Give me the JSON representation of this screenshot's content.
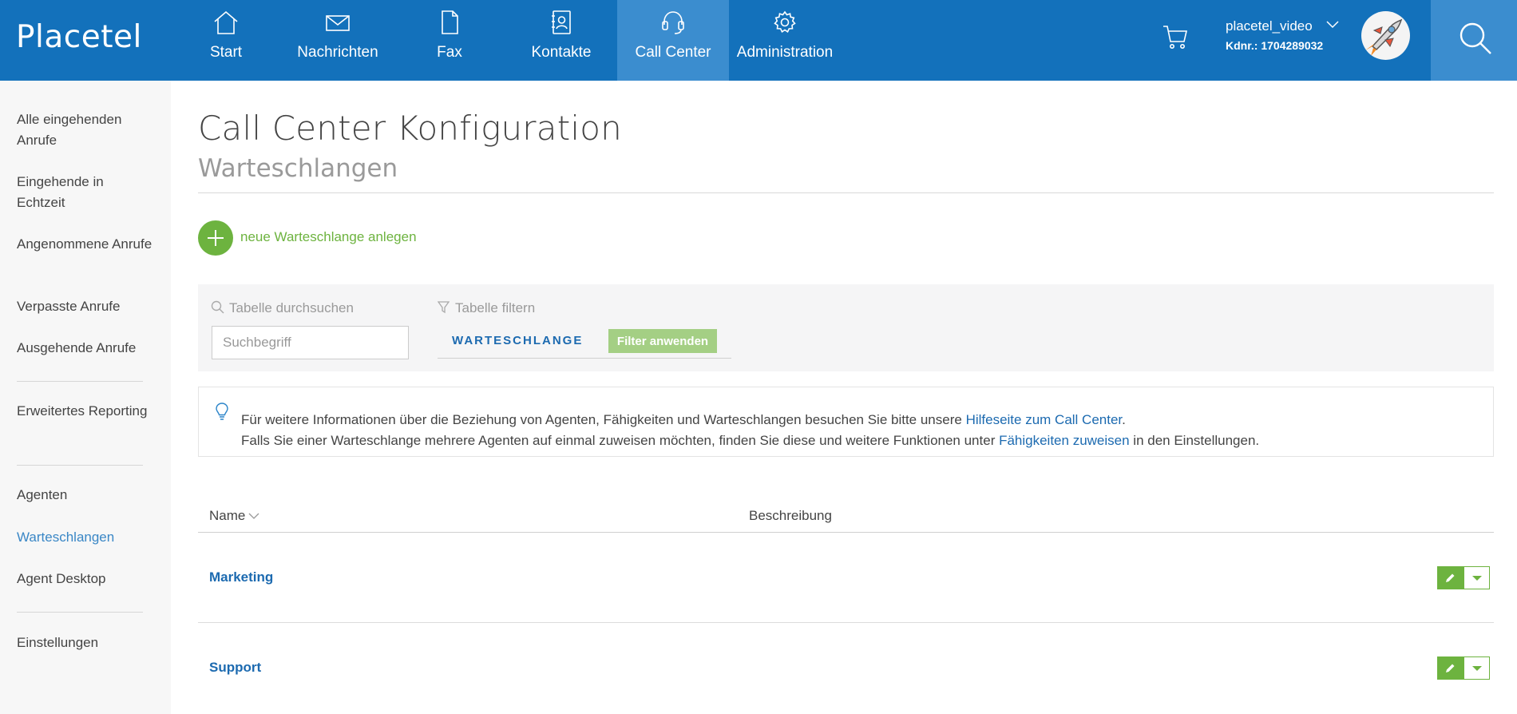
{
  "brand": {
    "logo": "Placetel",
    "primary": "#1371bb",
    "active_nav": "#3b8dcf",
    "accent_green": "#6db33f",
    "link_blue": "#1c6ab0"
  },
  "nav": {
    "items": [
      {
        "label": "Start",
        "icon": "home-icon"
      },
      {
        "label": "Nachrichten",
        "icon": "envelope-icon"
      },
      {
        "label": "Fax",
        "icon": "document-icon"
      },
      {
        "label": "Kontakte",
        "icon": "address-book-icon"
      },
      {
        "label": "Call Center",
        "icon": "headset-icon",
        "active": true
      },
      {
        "label": "Administration",
        "icon": "gear-icon"
      }
    ]
  },
  "user": {
    "name": "placetel_video",
    "kdnr": "Kdnr.: 1704289032",
    "avatar": "rocket-avatar"
  },
  "sidebar": {
    "items": [
      {
        "label": "Alle eingehenden Anrufe"
      },
      {
        "label": "Eingehende in Echtzeit"
      },
      {
        "label": "Angenommene Anrufe"
      },
      {
        "label": "Verpasste Anrufe"
      },
      {
        "label": "Ausgehende Anrufe"
      },
      {
        "label": "Erweitertes Reporting"
      },
      {
        "label": "Agenten"
      },
      {
        "label": "Warteschlangen",
        "active": true
      },
      {
        "label": "Agent Desktop"
      },
      {
        "label": "Einstellungen"
      }
    ]
  },
  "main": {
    "title": "Call Center Konfiguration",
    "subtitle": "Warteschlangen",
    "add_label": "neue Warteschlange anlegen"
  },
  "filter": {
    "search_label": "Tabelle durchsuchen",
    "search_placeholder": "Suchbegriff",
    "filter_label": "Tabelle filtern",
    "chip": "WARTESCHLANGE",
    "apply": "Filter anwenden"
  },
  "info": {
    "line1_pre": "Für weitere Informationen über die Beziehung von Agenten, Fähigkeiten und Warteschlangen besuchen Sie bitte unsere ",
    "line1_link": "Hilfeseite zum Call Center",
    "line1_post": ".",
    "line2_pre": "Falls Sie einer Warteschlange mehrere Agenten auf einmal zuweisen möchten, finden Sie diese und weitere Funktionen unter ",
    "line2_link": "Fähigkeiten zuweisen",
    "line2_post": " in den Einstellungen."
  },
  "table": {
    "columns": [
      "Name",
      "Beschreibung"
    ],
    "rows": [
      {
        "name": "Marketing",
        "description": ""
      },
      {
        "name": "Support",
        "description": ""
      }
    ]
  }
}
